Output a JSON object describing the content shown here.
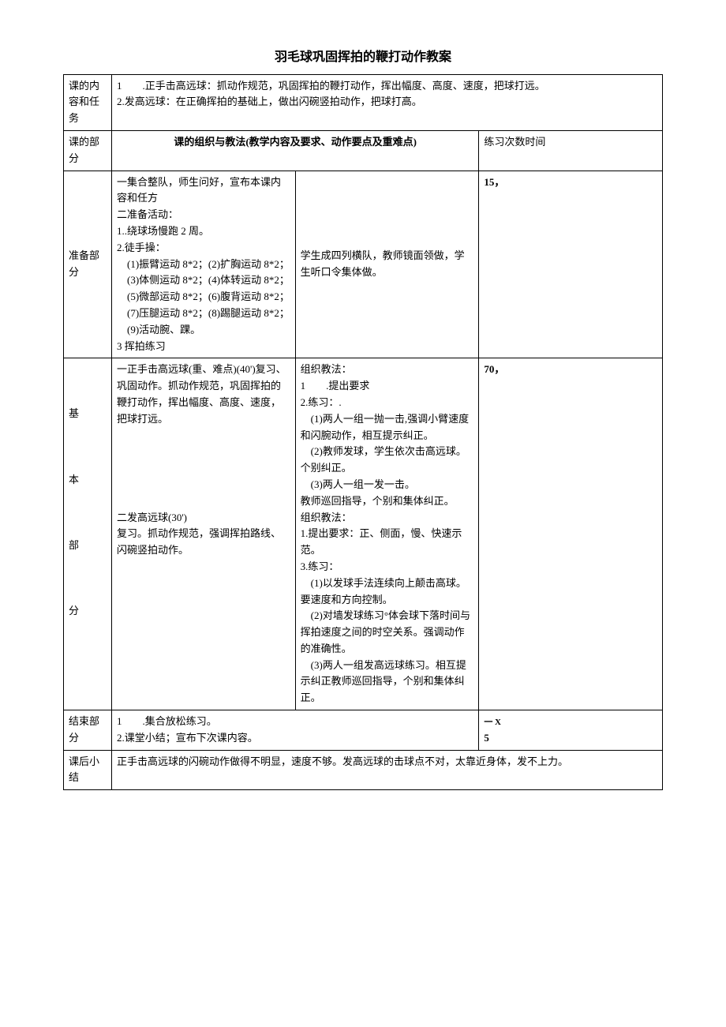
{
  "title": "羽毛球巩固挥拍的鞭打动作教案",
  "rows": {
    "content_task_label": "课的内容和任务",
    "content_task_body": "1　　.正手击高远球：抓动作规范，巩固挥拍的鞭打动作，挥出幅度、高度、速度，把球打远。\n2.发高远球：在正确挥拍的基础上，做出闪碗竖拍动作，把球打高。",
    "part_label": "课的部分",
    "org_header": "课的组织与教法(教学内容及要求、动作要点及重难点)",
    "time_header": "练习次数时间",
    "prep_label": "准备部分",
    "prep_left": "一集合整队，师生问好，宣布本课内容和任方\n二准备活动：\n1..绕球场慢跑 2 周。\n2.徒手操：\n　(1)振臂运动 8*2；(2)扩胸运动 8*2；\n　(3)体侧运动 8*2；(4)体转运动 8*2；\n　(5)微部运动 8*2；(6)腹背运动 8*2；\n　(7)压腿运动 8*2；(8)踢腿运动 8*2；\n　(9)活动腕、踝。\n3 挥拍练习",
    "prep_right": "学生成四列横队，教师镜面领做，学生听口令集体做。",
    "prep_time": "15，",
    "main_label": "基\n\n\n\n本\n\n\n\n部\n\n\n\n分",
    "main_left": "一正手击高远球(重、难点)(40')复习、巩固动作。抓动作规范，巩固挥拍的鞭打动作，挥出幅度、高度、速度，把球打远。\n\n\n\n\n\n二发高远球(30')\n复习。抓动作规范，强调挥拍路线、闪碗竖拍动作。",
    "main_right": "组织教法：\n1　　.提出要求\n2.练习：.\n　(1)两人一组一抛一击,强调小臂速度和闪腕动作，相互提示纠正。\n　(2)教师发球，学生依次击高远球。个别纠正。\n　(3)两人一组一发一击。\n教师巡回指导，个别和集体纠正。\n组织教法：\n1.提出要求：正、侧面，慢、快速示范。\n3.练习：\n　(1)以发球手法连续向上颠击高球。要速度和方向控制。\n　(2)对墙发球练习°体会球下落时间与挥拍速度之间的时空关系。强调动作的准确性。\n　(3)两人一组发高远球练习。相互提示纠正教师巡回指导，个别和集体纠正。",
    "main_time": "70，",
    "end_label": "结束部分",
    "end_body": "1　　.集合放松练习。\n2.课堂小结；宣布下次课内容。",
    "end_time_top": "一 X",
    "end_time_bottom": "5",
    "after_label": "课后小结",
    "after_body": "正手击高远球的闪碗动作做得不明显，速度不够。发高远球的击球点不对，太靠近身体，发不上力。"
  }
}
